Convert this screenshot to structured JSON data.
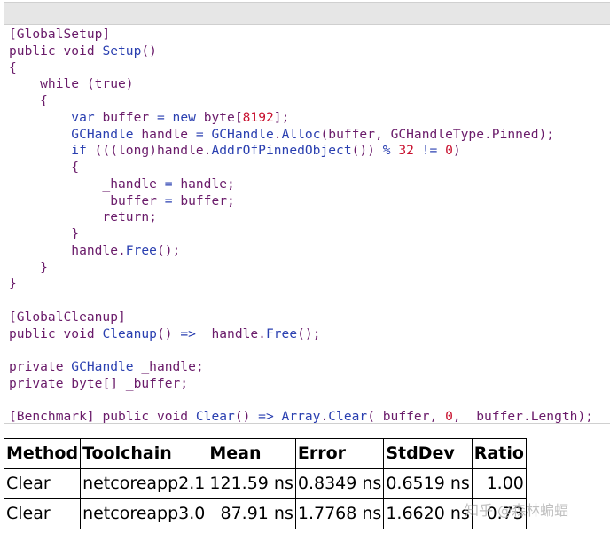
{
  "colors": {
    "code_default": "#6a1b6a",
    "code_type": "#2a3fb0",
    "code_number": "#c8102e",
    "header_bar": "#e6e6e6",
    "table_border": "#000000"
  },
  "code_lines": [
    [
      {
        "t": "[GlobalSetup]",
        "c": "plain"
      }
    ],
    [
      {
        "t": "public void ",
        "c": "kw"
      },
      {
        "t": "Setup",
        "c": "type"
      },
      {
        "t": "()",
        "c": "plain"
      }
    ],
    [
      {
        "t": "{",
        "c": "plain"
      }
    ],
    [
      {
        "t": "    while (true)",
        "c": "kw"
      }
    ],
    [
      {
        "t": "    {",
        "c": "plain"
      }
    ],
    [
      {
        "t": "        var ",
        "c": "type"
      },
      {
        "t": "buffer ",
        "c": "plain"
      },
      {
        "t": "= ",
        "c": "op"
      },
      {
        "t": "new ",
        "c": "type"
      },
      {
        "t": "byte[",
        "c": "plain"
      },
      {
        "t": "8192",
        "c": "num"
      },
      {
        "t": "];",
        "c": "plain"
      }
    ],
    [
      {
        "t": "        GCHandle ",
        "c": "type"
      },
      {
        "t": "handle ",
        "c": "plain"
      },
      {
        "t": "= ",
        "c": "op"
      },
      {
        "t": "GCHandle",
        "c": "type"
      },
      {
        "t": ".",
        "c": "plain"
      },
      {
        "t": "Alloc",
        "c": "type"
      },
      {
        "t": "(buffer, GCHandleType.Pinned);",
        "c": "plain"
      }
    ],
    [
      {
        "t": "        if ",
        "c": "type"
      },
      {
        "t": "(((long)handle.",
        "c": "plain"
      },
      {
        "t": "AddrOfPinnedObject",
        "c": "type"
      },
      {
        "t": "()) ",
        "c": "plain"
      },
      {
        "t": "% ",
        "c": "op"
      },
      {
        "t": "32 ",
        "c": "num"
      },
      {
        "t": "!= ",
        "c": "op"
      },
      {
        "t": "0",
        "c": "num"
      },
      {
        "t": ")",
        "c": "plain"
      }
    ],
    [
      {
        "t": "        {",
        "c": "plain"
      }
    ],
    [
      {
        "t": "            _handle ",
        "c": "plain"
      },
      {
        "t": "= ",
        "c": "op"
      },
      {
        "t": "handle;",
        "c": "plain"
      }
    ],
    [
      {
        "t": "            _buffer ",
        "c": "plain"
      },
      {
        "t": "= ",
        "c": "op"
      },
      {
        "t": "buffer;",
        "c": "plain"
      }
    ],
    [
      {
        "t": "            return;",
        "c": "plain"
      }
    ],
    [
      {
        "t": "        }",
        "c": "plain"
      }
    ],
    [
      {
        "t": "        handle.",
        "c": "plain"
      },
      {
        "t": "Free",
        "c": "type"
      },
      {
        "t": "();",
        "c": "plain"
      }
    ],
    [
      {
        "t": "    }",
        "c": "plain"
      }
    ],
    [
      {
        "t": "}",
        "c": "plain"
      }
    ],
    [
      {
        "t": "",
        "c": "plain"
      }
    ],
    [
      {
        "t": "[GlobalCleanup]",
        "c": "plain"
      }
    ],
    [
      {
        "t": "public void ",
        "c": "kw"
      },
      {
        "t": "Cleanup",
        "c": "type"
      },
      {
        "t": "() ",
        "c": "plain"
      },
      {
        "t": "=> ",
        "c": "op"
      },
      {
        "t": "_handle.",
        "c": "plain"
      },
      {
        "t": "Free",
        "c": "type"
      },
      {
        "t": "();",
        "c": "plain"
      }
    ],
    [
      {
        "t": "",
        "c": "plain"
      }
    ],
    [
      {
        "t": "private ",
        "c": "kw"
      },
      {
        "t": "GCHandle ",
        "c": "type"
      },
      {
        "t": "_handle;",
        "c": "plain"
      }
    ],
    [
      {
        "t": "private ",
        "c": "kw"
      },
      {
        "t": "byte[] _buffer;",
        "c": "plain"
      }
    ],
    [
      {
        "t": "",
        "c": "plain"
      }
    ],
    [
      {
        "t": "[Benchmark] ",
        "c": "plain"
      },
      {
        "t": "public void ",
        "c": "kw"
      },
      {
        "t": "Clear",
        "c": "type"
      },
      {
        "t": "() ",
        "c": "plain"
      },
      {
        "t": "=> ",
        "c": "op"
      },
      {
        "t": "Array",
        "c": "type"
      },
      {
        "t": ".",
        "c": "plain"
      },
      {
        "t": "Clear",
        "c": "type"
      },
      {
        "t": "(_buffer, ",
        "c": "plain"
      },
      {
        "t": "0",
        "c": "num"
      },
      {
        "t": ", _buffer.Length);",
        "c": "plain"
      }
    ]
  ],
  "results_table": {
    "headers": [
      "Method",
      "Toolchain",
      "Mean",
      "Error",
      "StdDev",
      "Ratio"
    ],
    "rows": [
      [
        "Clear",
        "netcoreapp2.1",
        "121.59 ns",
        "0.8349 ns",
        "0.6519 ns",
        "1.00"
      ],
      [
        "Clear",
        "netcoreapp3.0",
        "87.91 ns",
        "1.7768 ns",
        "1.6620 ns",
        "0.73"
      ]
    ]
  },
  "watermark": "知乎 @森林蝙蝠"
}
